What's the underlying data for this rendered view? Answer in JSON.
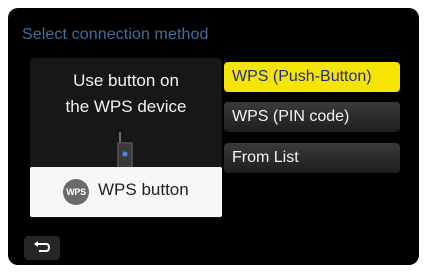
{
  "header": {
    "title": "Select connection method"
  },
  "panel": {
    "instruction_line1": "Use button on",
    "instruction_line2": "the WPS device",
    "icon_label": "WPS",
    "button_label": "WPS button"
  },
  "options": [
    {
      "label": "WPS (Push-Button)",
      "selected": true
    },
    {
      "label": "WPS (PIN code)",
      "selected": false
    },
    {
      "label": "From List",
      "selected": false
    }
  ],
  "colors": {
    "header": "#3f6f9d",
    "selected_bg": "#f5e500",
    "selected_text": "#1e2c8a"
  },
  "icons": {
    "back": "return-arrow-icon",
    "router": "router-icon",
    "wps": "wps-icon"
  }
}
